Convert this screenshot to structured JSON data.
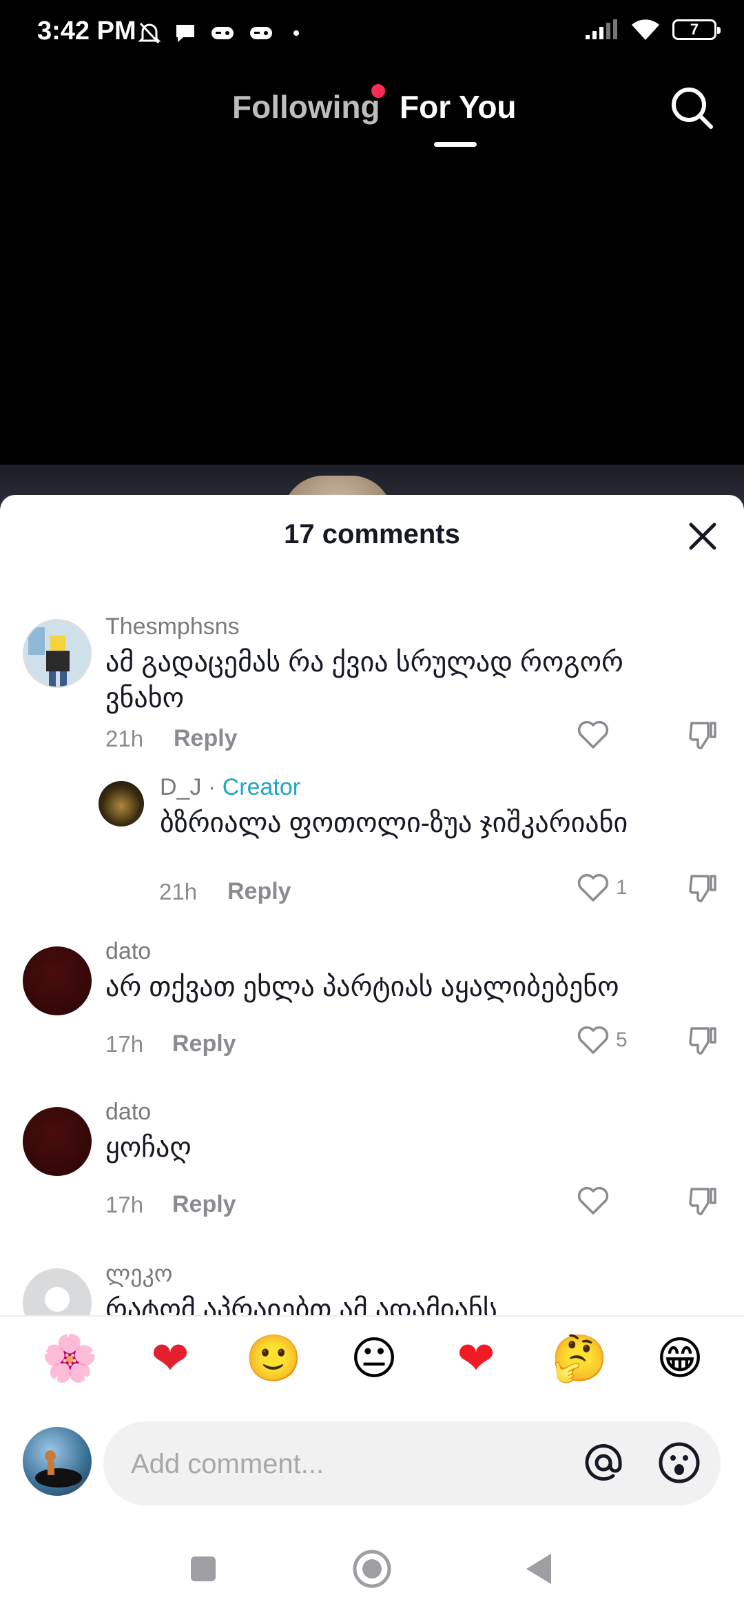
{
  "status_bar": {
    "time": "3:42 PM",
    "battery": "7"
  },
  "top_nav": {
    "following": "Following",
    "for_you": "For You",
    "accent_color": "#fe2c55"
  },
  "sheet": {
    "title": "17 comments"
  },
  "comments": [
    {
      "user": "Thesmphsns",
      "text": "ამ გადაცემას რა ქვია სრულად როგორ ვნახო",
      "time": "21h",
      "reply": "Reply",
      "likes": ""
    },
    {
      "user": "D_J",
      "separator": "·",
      "badge": "Creator",
      "text": "ბზრიალა ფოთოლი-ზუა ჯიშკარიანი",
      "time": "21h",
      "reply": "Reply",
      "likes": "1"
    },
    {
      "user": "dato",
      "text": "არ თქვათ ეხლა პარტიას აყალიბებენო",
      "time": "17h",
      "reply": "Reply",
      "likes": "5"
    },
    {
      "user": "dato",
      "text": "ყოჩაღ",
      "time": "17h",
      "reply": "Reply",
      "likes": ""
    },
    {
      "user": "ლეკო",
      "text": "რატომ აპრაიებთ ამ ადამიანს"
    }
  ],
  "emoji_bar": [
    "🌸",
    "❤",
    "🙂",
    "😐",
    "❤",
    "🤔",
    "😁"
  ],
  "input": {
    "placeholder": "Add comment..."
  }
}
